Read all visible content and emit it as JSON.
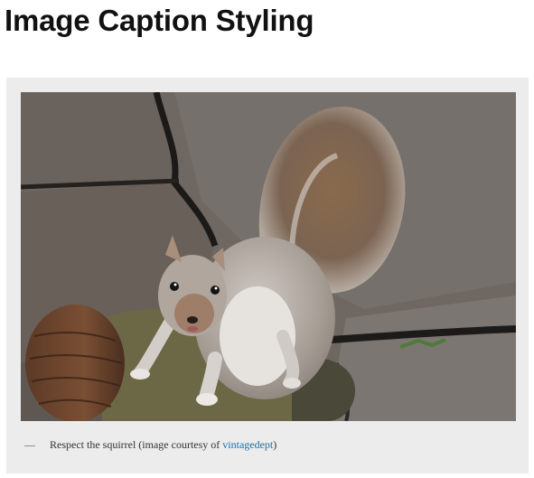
{
  "page": {
    "title": "Image Caption Styling"
  },
  "figure": {
    "image_subject": "squirrel",
    "caption": {
      "dash": "—",
      "text_before": "Respect the squirrel (image courtesy of ",
      "link_text": "vintagedept",
      "text_after": ")"
    }
  },
  "colors": {
    "title": "#111111",
    "figure_background": "#ececec",
    "caption_text": "#333333",
    "link": "#1e6ea7"
  }
}
